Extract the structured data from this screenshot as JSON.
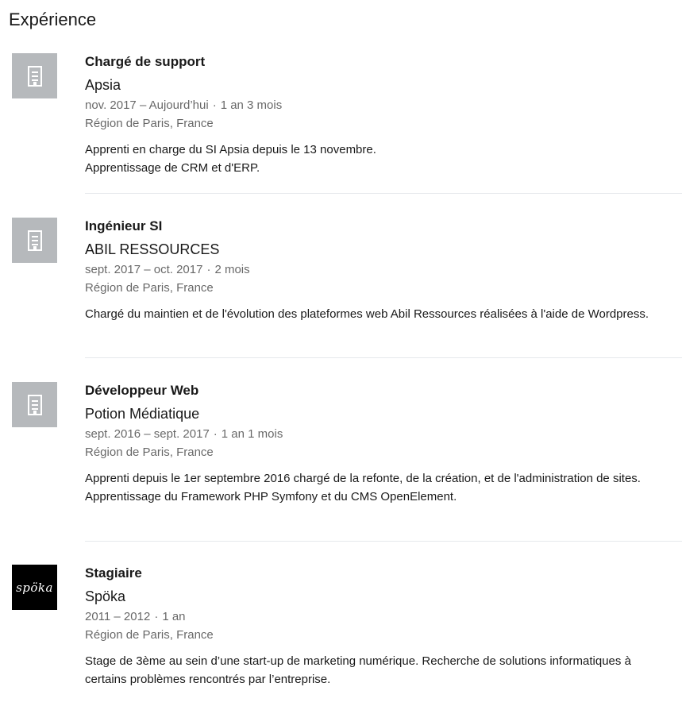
{
  "section": {
    "title": "Expérience"
  },
  "entries": [
    {
      "role": "Chargé de support",
      "company": "Apsia",
      "date_range": "nov. 2017 – Aujourd’hui",
      "duration": "1 an 3 mois",
      "location": "Région de Paris, France",
      "description": [
        "Apprenti en charge du SI Apsia depuis le 13 novembre.",
        "Apprentissage de CRM et d'ERP."
      ],
      "logo_icon": "building-icon"
    },
    {
      "role": "Ingénieur SI",
      "company": "ABIL RESSOURCES",
      "date_range": "sept. 2017 – oct. 2017",
      "duration": "2 mois",
      "location": "Région de Paris, France",
      "description": [
        "Chargé du maintien et de l'évolution des plateformes web Abil Ressources réalisées à l'aide de Wordpress."
      ],
      "logo_icon": "building-icon"
    },
    {
      "role": "Développeur Web",
      "company": "Potion Médiatique",
      "date_range": "sept. 2016 – sept. 2017",
      "duration": "1 an 1 mois",
      "location": "Région de Paris, France",
      "description": [
        "Apprenti depuis le 1er septembre 2016 chargé de la refonte, de la création, et de l'administration de sites.",
        "Apprentissage du Framework PHP Symfony et du CMS OpenElement."
      ],
      "logo_icon": "building-icon"
    },
    {
      "role": "Stagiaire",
      "company": "Spöka",
      "date_range": "2011 – 2012",
      "duration": "1 an",
      "location": "Région de Paris, France",
      "description": [
        "Stage de 3ème au sein d’une start-up de marketing numérique. Recherche de solutions informatiques à certains problèmes rencontrés par l’entreprise."
      ],
      "logo_text": "spöka",
      "logo_icon": "spoka-logo"
    }
  ],
  "colors": {
    "placeholder_logo": "#b6b9bc",
    "divider": "#e6e9ec",
    "secondary_text": "rgba(0,0,0,0.6)"
  }
}
